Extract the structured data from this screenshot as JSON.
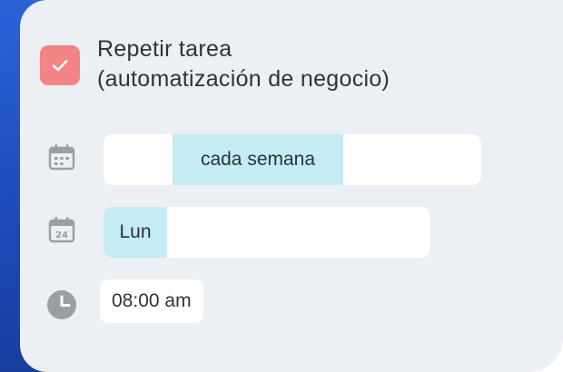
{
  "task": {
    "repeat_checked": true,
    "repeat_label_line1": "Repetir tarea",
    "repeat_label_line2": "(automatización de negocio)"
  },
  "frequency": {
    "options": [
      "",
      "cada semana",
      "",
      ""
    ],
    "selected_index": 1
  },
  "weekday": {
    "options": [
      "Lun",
      "",
      "",
      "",
      ""
    ],
    "selected_index": 0
  },
  "time": {
    "value": "08:00 am"
  },
  "icons": {
    "checkbox": "check-icon",
    "frequency": "calendar-grid-icon",
    "weekday": "calendar-day-icon",
    "time": "clock-icon",
    "weekday_icon_number": "24"
  },
  "colors": {
    "accent": "#f38384",
    "selected": "#c4ecf2",
    "card_bg": "#eceff3",
    "side_blue": "#2d63d8"
  }
}
